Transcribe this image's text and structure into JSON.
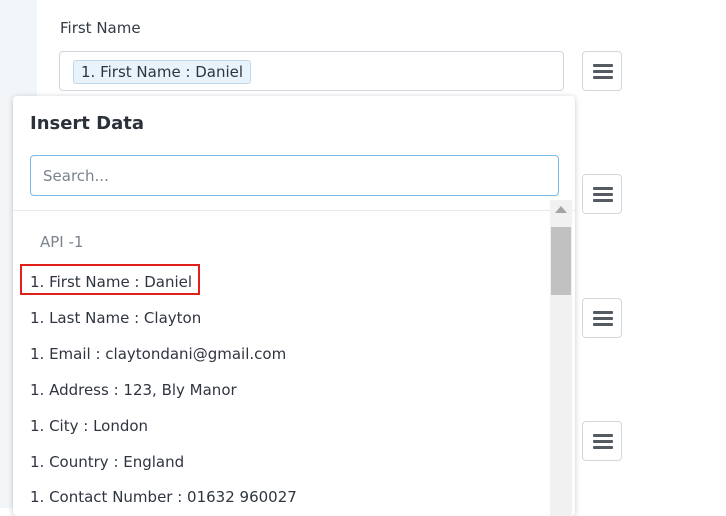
{
  "form": {
    "field_label": "First Name",
    "token_label": "1. First Name : Daniel"
  },
  "menu_icon": "hamburger-icon",
  "insert_panel": {
    "title": "Insert Data",
    "search_placeholder": "Search...",
    "group_label": "API -1",
    "items": [
      {
        "label": "1. First Name : Daniel"
      },
      {
        "label": "1. Last Name : Clayton"
      },
      {
        "label": "1. Email : claytondani@gmail.com"
      },
      {
        "label": "1. Address : 123, Bly Manor"
      },
      {
        "label": "1. City : London"
      },
      {
        "label": "1. Country : England"
      },
      {
        "label": "1. Contact Number : 01632 960027"
      }
    ]
  },
  "colors": {
    "highlight": "#e0201b",
    "search_focus": "#7ab9e3",
    "token_bg": "#e9f3fb"
  }
}
